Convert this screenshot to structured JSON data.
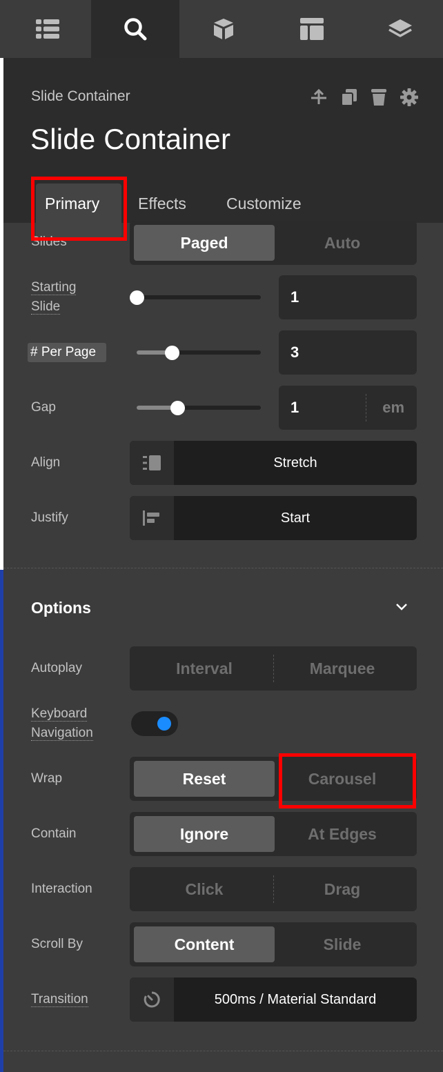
{
  "topbar": {
    "icons": [
      "list-icon",
      "search-icon",
      "cube-icon",
      "layout-icon",
      "layers-icon"
    ]
  },
  "header": {
    "breadcrumb": "Slide Container",
    "title": "Slide Container",
    "actions": [
      "move-up-icon",
      "duplicate-icon",
      "delete-icon",
      "settings-icon"
    ],
    "tabs": [
      "Primary",
      "Effects",
      "Customize"
    ]
  },
  "primary": {
    "slides": {
      "label": "Slides",
      "options": [
        "Paged",
        "Auto"
      ],
      "selected": "Paged"
    },
    "starting_slide": {
      "label_line1": "Starting",
      "label_line2": "Slide",
      "value": "1"
    },
    "per_page": {
      "label": "# Per Page",
      "value": "3"
    },
    "gap": {
      "label": "Gap",
      "value": "1",
      "unit": "em"
    },
    "align": {
      "label": "Align",
      "value": "Stretch"
    },
    "justify": {
      "label": "Justify",
      "value": "Start"
    }
  },
  "options": {
    "title": "Options",
    "autoplay": {
      "label": "Autoplay",
      "options": [
        "Interval",
        "Marquee"
      ]
    },
    "keyboard": {
      "label_line1": "Keyboard",
      "label_line2": "Navigation",
      "on": true
    },
    "wrap": {
      "label": "Wrap",
      "options": [
        "Reset",
        "Carousel"
      ],
      "selected": "Reset"
    },
    "contain": {
      "label": "Contain",
      "options": [
        "Ignore",
        "At Edges"
      ],
      "selected": "Ignore"
    },
    "interaction": {
      "label": "Interaction",
      "options": [
        "Click",
        "Drag"
      ]
    },
    "scroll_by": {
      "label": "Scroll By",
      "options": [
        "Content",
        "Slide"
      ],
      "selected": "Content"
    },
    "transition": {
      "label": "Transition",
      "value": "500ms / Material Standard"
    }
  },
  "colors": {
    "highlight": "#ff0000",
    "toggle_on": "#1a8cff"
  }
}
